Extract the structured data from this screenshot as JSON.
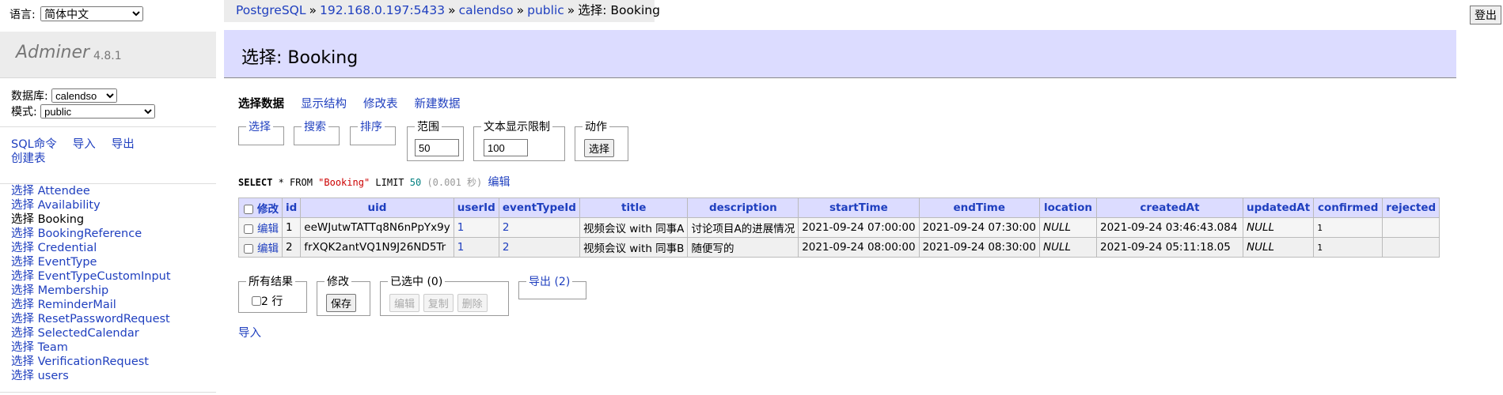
{
  "lang": {
    "label": "语言:",
    "value": "简体中文"
  },
  "logout": "登出",
  "breadcrumb": {
    "system": "PostgreSQL",
    "server": "192.168.0.197:5433",
    "db": "calendso",
    "schema": "public",
    "current": "选择: Booking",
    "sep": "»"
  },
  "brand": {
    "name": "Adminer",
    "version": "4.8.1"
  },
  "dbsel": {
    "db_label": "数据库:",
    "db_value": "calendso",
    "schema_label": "模式:",
    "schema_value": "public"
  },
  "links": {
    "sql": "SQL命令",
    "import": "导入",
    "export": "导出",
    "create": "创建表"
  },
  "tables": [
    {
      "sel": "选择",
      "name": "Attendee"
    },
    {
      "sel": "选择",
      "name": "Availability"
    },
    {
      "sel": "选择",
      "name": "Booking"
    },
    {
      "sel": "选择",
      "name": "BookingReference"
    },
    {
      "sel": "选择",
      "name": "Credential"
    },
    {
      "sel": "选择",
      "name": "EventType"
    },
    {
      "sel": "选择",
      "name": "EventTypeCustomInput"
    },
    {
      "sel": "选择",
      "name": "Membership"
    },
    {
      "sel": "选择",
      "name": "ReminderMail"
    },
    {
      "sel": "选择",
      "name": "ResetPasswordRequest"
    },
    {
      "sel": "选择",
      "name": "SelectedCalendar"
    },
    {
      "sel": "选择",
      "name": "Team"
    },
    {
      "sel": "选择",
      "name": "VerificationRequest"
    },
    {
      "sel": "选择",
      "name": "users"
    }
  ],
  "title": "选择: Booking",
  "tabs": {
    "select": "选择数据",
    "structure": "显示结构",
    "alter": "修改表",
    "new": "新建数据"
  },
  "filters": {
    "select": "选择",
    "search": "搜索",
    "sort": "排序",
    "limit_label": "范围",
    "limit_value": "50",
    "text_label": "文本显示限制",
    "text_value": "100",
    "action_label": "动作",
    "action_btn": "选择"
  },
  "sql": {
    "p1": "SELECT",
    "p2": " * FROM ",
    "table": "\"Booking\"",
    "p3": " LIMIT ",
    "limit": "50",
    "time": " (0.001 秒) ",
    "edit": "编辑"
  },
  "grid": {
    "modify_header": "修改",
    "columns": [
      "id",
      "uid",
      "userId",
      "eventTypeId",
      "title",
      "description",
      "startTime",
      "endTime",
      "location",
      "createdAt",
      "updatedAt",
      "confirmed",
      "rejected"
    ],
    "rows": [
      {
        "edit": "编辑",
        "id": "1",
        "uid": "eeWJutwTATTq8N6nPpYx9y",
        "userId": "1",
        "eventTypeId": "2",
        "title": "视频会议 with 同事A",
        "description": "讨论项目A的进展情况",
        "startTime": "2021-09-24 07:00:00",
        "endTime": "2021-09-24 07:30:00",
        "location": "NULL",
        "createdAt": "2021-09-24 03:46:43.084",
        "updatedAt": "NULL",
        "confirmed": "1",
        "rejected": ""
      },
      {
        "edit": "编辑",
        "id": "2",
        "uid": "frXQK2antVQ1N9J26ND5Tr",
        "userId": "1",
        "eventTypeId": "2",
        "title": "视频会议 with 同事B",
        "description": "随便写的",
        "startTime": "2021-09-24 08:00:00",
        "endTime": "2021-09-24 08:30:00",
        "location": "NULL",
        "createdAt": "2021-09-24 05:11:18.05",
        "updatedAt": "NULL",
        "confirmed": "1",
        "rejected": ""
      }
    ]
  },
  "footer": {
    "all_label": "所有结果",
    "rows_count": "2 行",
    "modify_label": "修改",
    "save": "保存",
    "selected_label": "已选中 (0)",
    "edit": "编辑",
    "clone": "复制",
    "delete": "删除",
    "export_label": "导出 (2)",
    "import": "导入"
  }
}
